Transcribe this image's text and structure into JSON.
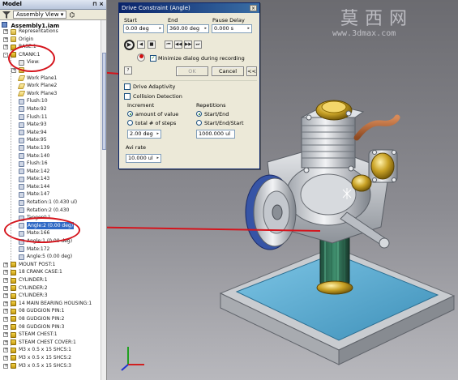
{
  "browser": {
    "title": "Model",
    "dropdown_label": "Assembly View",
    "root": "Assembly1.iam",
    "items": [
      {
        "label": "Representations",
        "indent": 1,
        "icon": "folder",
        "exp": "+"
      },
      {
        "label": "Origin",
        "indent": 1,
        "icon": "folder",
        "exp": "+"
      },
      {
        "label": "BASE:1",
        "indent": 1,
        "icon": "part",
        "exp": "+"
      },
      {
        "label": "CRANK:1",
        "indent": 1,
        "icon": "part",
        "exp": "-"
      },
      {
        "label": "View:",
        "indent": 2,
        "icon": "view",
        "exp": ""
      },
      {
        "label": "",
        "indent": 2,
        "icon": "folder",
        "exp": "+"
      },
      {
        "label": "Work Plane1",
        "indent": 2,
        "icon": "plane",
        "exp": ""
      },
      {
        "label": "Work Plane2",
        "indent": 2,
        "icon": "plane",
        "exp": ""
      },
      {
        "label": "Work Plane3",
        "indent": 2,
        "icon": "plane",
        "exp": ""
      },
      {
        "label": "Flush:10",
        "indent": 2,
        "icon": "constraint",
        "exp": ""
      },
      {
        "label": "Mate:92",
        "indent": 2,
        "icon": "constraint",
        "exp": ""
      },
      {
        "label": "Flush:11",
        "indent": 2,
        "icon": "constraint",
        "exp": ""
      },
      {
        "label": "Mate:93",
        "indent": 2,
        "icon": "constraint",
        "exp": ""
      },
      {
        "label": "Mate:94",
        "indent": 2,
        "icon": "constraint",
        "exp": ""
      },
      {
        "label": "Mate:95",
        "indent": 2,
        "icon": "constraint",
        "exp": ""
      },
      {
        "label": "Mate:139",
        "indent": 2,
        "icon": "constraint",
        "exp": ""
      },
      {
        "label": "Mate:140",
        "indent": 2,
        "icon": "constraint",
        "exp": ""
      },
      {
        "label": "Flush:16",
        "indent": 2,
        "icon": "constraint",
        "exp": ""
      },
      {
        "label": "Mate:142",
        "indent": 2,
        "icon": "constraint",
        "exp": ""
      },
      {
        "label": "Mate:143",
        "indent": 2,
        "icon": "constraint",
        "exp": ""
      },
      {
        "label": "Mate:144",
        "indent": 2,
        "icon": "constraint",
        "exp": ""
      },
      {
        "label": "Mate:147",
        "indent": 2,
        "icon": "constraint",
        "exp": ""
      },
      {
        "label": "Rotation:1 (0.430 ul)",
        "indent": 2,
        "icon": "constraint",
        "exp": ""
      },
      {
        "label": "Rotation:2 (0.430",
        "indent": 2,
        "icon": "constraint",
        "exp": ""
      },
      {
        "label": "Tangent:1",
        "indent": 2,
        "icon": "constraint",
        "exp": ""
      },
      {
        "label": "Angle:2 (0.00 deg)",
        "indent": 2,
        "icon": "constraint",
        "exp": "",
        "selected": true
      },
      {
        "label": "Mate:166",
        "indent": 2,
        "icon": "constraint",
        "exp": ""
      },
      {
        "label": "Angle:1 (0.00 deg)",
        "indent": 2,
        "icon": "constraint",
        "exp": ""
      },
      {
        "label": "Mate:172",
        "indent": 2,
        "icon": "constraint",
        "exp": ""
      },
      {
        "label": "Angle:5 (0.00 deg)",
        "indent": 2,
        "icon": "constraint",
        "exp": ""
      },
      {
        "label": "MOUNT POST:1",
        "indent": 1,
        "icon": "part",
        "exp": "+"
      },
      {
        "label": "18 CRANK CASE:1",
        "indent": 1,
        "icon": "part",
        "exp": "+"
      },
      {
        "label": "CYLINDER:1",
        "indent": 1,
        "icon": "part",
        "exp": "+"
      },
      {
        "label": "CYLINDER:2",
        "indent": 1,
        "icon": "part",
        "exp": "+"
      },
      {
        "label": "CYLINDER:3",
        "indent": 1,
        "icon": "part",
        "exp": "+"
      },
      {
        "label": "14 MAIN BEARING HOUSING:1",
        "indent": 1,
        "icon": "part",
        "exp": "+"
      },
      {
        "label": "08 GUDGION PIN:1",
        "indent": 1,
        "icon": "part",
        "exp": "+"
      },
      {
        "label": "08 GUDGION PIN:2",
        "indent": 1,
        "icon": "part",
        "exp": "+"
      },
      {
        "label": "08 GUDGION PIN:3",
        "indent": 1,
        "icon": "part",
        "exp": "+"
      },
      {
        "label": "STEAM CHEST:1",
        "indent": 1,
        "icon": "part",
        "exp": "+"
      },
      {
        "label": "STEAM CHEST COVER:1",
        "indent": 1,
        "icon": "part",
        "exp": "+"
      },
      {
        "label": "M3 x 0.5 x 15 SHCS:1",
        "indent": 1,
        "icon": "part",
        "exp": "+"
      },
      {
        "label": "M3 x 0.5 x 15 SHCS:2",
        "indent": 1,
        "icon": "part",
        "exp": "+"
      },
      {
        "label": "M3 x 0.5 x 15 SHCS:3",
        "indent": 1,
        "icon": "part",
        "exp": "+"
      }
    ]
  },
  "dialog": {
    "title": "Drive Constraint (Angle)",
    "start_label": "Start",
    "start_value": "0.00 deg",
    "end_label": "End",
    "end_value": "360.00 deg",
    "pause_label": "Pause Delay",
    "pause_value": "0.000 s",
    "minimize_label": "Minimize dialog during recording",
    "minimize_checked": true,
    "ok_label": "OK",
    "cancel_label": "Cancel",
    "more_label": "<<",
    "drive_adaptivity_label": "Drive Adaptivity",
    "collision_label": "Collision Detection",
    "increment_label": "Increment",
    "amount_label": "amount of value",
    "total_steps_label": "total # of steps",
    "increment_value": "2.00 deg",
    "repetitions_label": "Repetitions",
    "start_end_label": "Start/End",
    "start_end_start_label": "Start/End/Start",
    "repetitions_value": "1000.000 ul",
    "avi_rate_label": "Avi rate",
    "avi_rate_value": "10.000 ul"
  },
  "watermark": {
    "chinese": "莫西网",
    "url": "www.3dmax.com"
  },
  "colors": {
    "annotation_red": "#d5141c",
    "selection_blue": "#316ac5",
    "dialog_bg": "#ece9d8"
  }
}
